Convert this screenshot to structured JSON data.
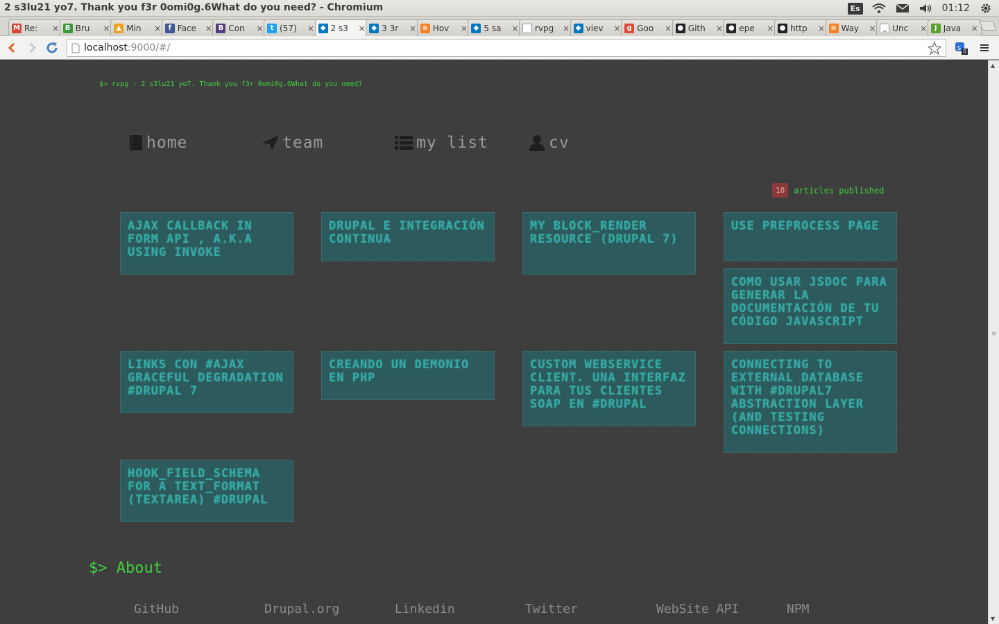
{
  "os": {
    "window_title": "2 s3lu21 yo7. Thank you f3r 0omi0g.6What do you need? - Chromium",
    "keyboard_layout": "Es",
    "clock": "01:12"
  },
  "tabs": [
    {
      "title": "Re:",
      "icon": "gmail-icon",
      "color": "#d44638",
      "glyph": "M",
      "active": false
    },
    {
      "title": "Bru",
      "icon": "bruno-icon",
      "color": "#3a9a3a",
      "glyph": "B",
      "active": false
    },
    {
      "title": "Min",
      "icon": "flame-icon",
      "color": "#f0a020",
      "glyph": "▲",
      "active": false
    },
    {
      "title": "Face",
      "icon": "facebook-icon",
      "color": "#3b5998",
      "glyph": "f",
      "active": false
    },
    {
      "title": "Con",
      "icon": "bootstrap-icon",
      "color": "#563d7c",
      "glyph": "B",
      "active": false
    },
    {
      "title": "(57)",
      "icon": "twitter-icon",
      "color": "#1da1f2",
      "glyph": "t",
      "active": false
    },
    {
      "title": "2 s3",
      "icon": "drupal-icon",
      "color": "#0678be",
      "glyph": "◆",
      "active": true
    },
    {
      "title": "3 3r",
      "icon": "drupal-icon",
      "color": "#0678be",
      "glyph": "◆",
      "active": false
    },
    {
      "title": "Hov",
      "icon": "stack-icon",
      "color": "#f48024",
      "glyph": "≡",
      "active": false
    },
    {
      "title": "5 sa",
      "icon": "drupal-icon",
      "color": "#0678be",
      "glyph": "◆",
      "active": false
    },
    {
      "title": "rvpg",
      "icon": "page-icon",
      "color": "#ffffff",
      "glyph": "",
      "active": false
    },
    {
      "title": "viev",
      "icon": "drupal-icon",
      "color": "#0678be",
      "glyph": "◆",
      "active": false
    },
    {
      "title": "Goo",
      "icon": "google-icon",
      "color": "#dd4b39",
      "glyph": "g",
      "active": false
    },
    {
      "title": "Gith",
      "icon": "github-icon",
      "color": "#222222",
      "glyph": "●",
      "active": false
    },
    {
      "title": "epe",
      "icon": "github-icon",
      "color": "#222222",
      "glyph": "●",
      "active": false
    },
    {
      "title": "http",
      "icon": "github-icon",
      "color": "#222222",
      "glyph": "●",
      "active": false
    },
    {
      "title": "Way",
      "icon": "stack-icon",
      "color": "#f48024",
      "glyph": "≡",
      "active": false
    },
    {
      "title": "Unc",
      "icon": "underscore-icon",
      "color": "#ffffff",
      "glyph": "_",
      "active": false
    },
    {
      "title": "Java",
      "icon": "js-icon",
      "color": "#5aa02c",
      "glyph": "J",
      "active": false
    }
  ],
  "toolbar": {
    "url_host": "localhost",
    "url_rest": ":9000/#/",
    "extension_badge": "0"
  },
  "page": {
    "prompt": "$> rvpg - 2 s3lu21 yo7. Thank you f3r 0omi0g.6What do you need?",
    "nav": [
      {
        "label": "home",
        "icon": "book-icon"
      },
      {
        "label": "team",
        "icon": "paper-plane-icon"
      },
      {
        "label": "my list",
        "icon": "list-icon"
      },
      {
        "label": "cv",
        "icon": "user-icon"
      }
    ],
    "article_count": "10",
    "article_count_label": "articles published",
    "articles": [
      "Ajax callback in Form API , a.k.a using invoke",
      "Drupal e integración continua",
      "My block_render resource (Drupal 7)",
      "Use preprocess page",
      "Como usar JSDoc para generar la documentación de tu código Javascript",
      "Links con #ajax graceful degradation #drupal 7",
      "Creando un demonio en PHP",
      "Custom webservice client. Una interfaz para tus clientes SOAP en #Drupal",
      "Connecting to external database with #Drupal7 abstraction layer (and testing connections)",
      "Hook_field_schema for a text_format (textarea) #Drupal"
    ],
    "about_heading": "$> About",
    "footer_links": [
      "GitHub",
      "Drupal.org",
      "Linkedin",
      "Twitter",
      "WebSite API",
      "NPM"
    ]
  }
}
